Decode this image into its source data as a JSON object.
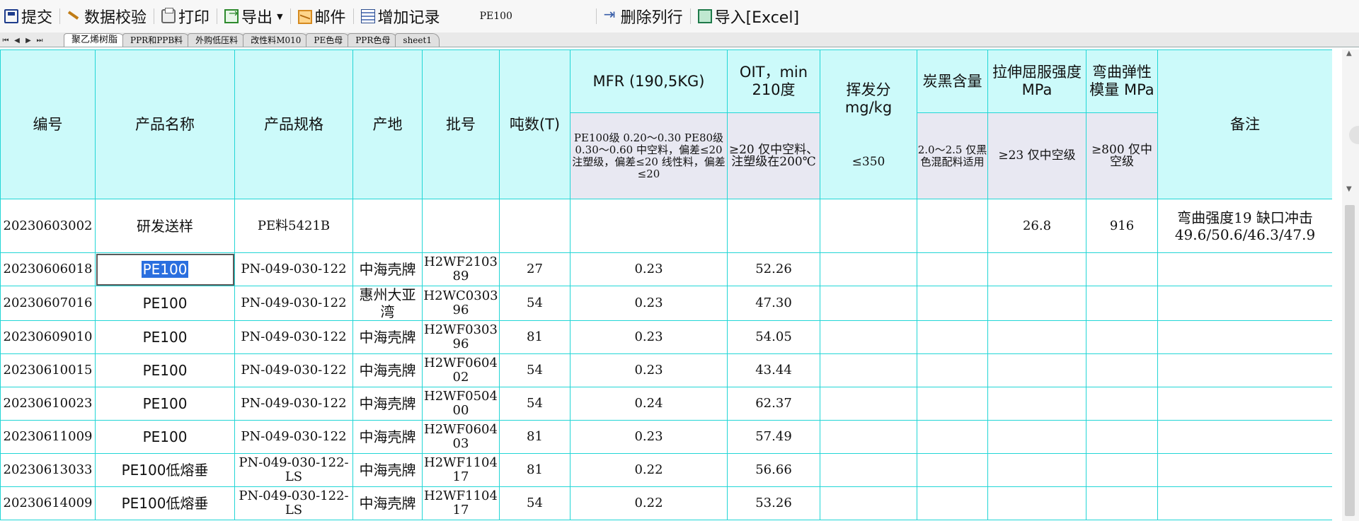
{
  "toolbar": {
    "submit": "提交",
    "validate": "数据校验",
    "print": "打印",
    "export": "导出",
    "mail": "邮件",
    "add_log": "增加记录",
    "product_field": "PE100",
    "delete_row": "删除列行",
    "import_excel": "导入[Excel]"
  },
  "tabs": [
    "聚乙烯树脂",
    "PPR和PPB料",
    "外购低压料",
    "改性料M010",
    "PE色母",
    "PPR色母",
    "sheet1"
  ],
  "header": {
    "code": "编号",
    "name": "产品名称",
    "spec": "产品规格",
    "origin": "产地",
    "batch": "批号",
    "tons": "吨数(T)",
    "mfr": "MFR (190,5KG)",
    "mfr_req": "PE100级 0.20～0.30 PE80级 0.30～0.60 中空料，偏差≤20 注塑级，偏差≤20 线性料，偏差≤20",
    "oit": "OIT，min 210度",
    "oit_req": "≥20 仅中空料、注塑级在200℃",
    "volatile": "挥发分 mg/kg",
    "volatile_req": "≤350",
    "carbon": "炭黑含量",
    "carbon_req": "2.0～2.5 仅黑色混配料适用",
    "tensile": "拉伸屈服强度 MPa",
    "tensile_req": "≥23 仅中空级",
    "flex": "弯曲弹性模量 MPa",
    "flex_req": "≥800 仅中空级",
    "remark": "备注"
  },
  "rows": [
    {
      "code": "20230603002",
      "name": "研发送样",
      "spec": "PE料5421B",
      "origin": "",
      "batch": "",
      "tons": "",
      "mfr": "",
      "oit": "",
      "volatile": "",
      "carbon": "",
      "tensile": "26.8",
      "flex": "916",
      "remark": "弯曲强度19 缺口冲击 49.6/50.6/46.3/47.9"
    },
    {
      "code": "20230606018",
      "name": "PE100",
      "spec": "PN-049-030-122",
      "origin": "中海壳牌",
      "batch": "H2WF210389",
      "tons": "27",
      "mfr": "0.23",
      "oit": "52.26",
      "volatile": "",
      "carbon": "",
      "tensile": "",
      "flex": "",
      "remark": ""
    },
    {
      "code": "20230607016",
      "name": "PE100",
      "spec": "PN-049-030-122",
      "origin": "惠州大亚湾",
      "batch": "H2WC030396",
      "tons": "54",
      "mfr": "0.23",
      "oit": "47.30",
      "volatile": "",
      "carbon": "",
      "tensile": "",
      "flex": "",
      "remark": ""
    },
    {
      "code": "20230609010",
      "name": "PE100",
      "spec": "PN-049-030-122",
      "origin": "中海壳牌",
      "batch": "H2WF030396",
      "tons": "81",
      "mfr": "0.23",
      "oit": "54.05",
      "volatile": "",
      "carbon": "",
      "tensile": "",
      "flex": "",
      "remark": ""
    },
    {
      "code": "20230610015",
      "name": "PE100",
      "spec": "PN-049-030-122",
      "origin": "中海壳牌",
      "batch": "H2WF060402",
      "tons": "54",
      "mfr": "0.23",
      "oit": "43.44",
      "volatile": "",
      "carbon": "",
      "tensile": "",
      "flex": "",
      "remark": ""
    },
    {
      "code": "20230610023",
      "name": "PE100",
      "spec": "PN-049-030-122",
      "origin": "中海壳牌",
      "batch": "H2WF050400",
      "tons": "54",
      "mfr": "0.24",
      "oit": "62.37",
      "volatile": "",
      "carbon": "",
      "tensile": "",
      "flex": "",
      "remark": ""
    },
    {
      "code": "20230611009",
      "name": "PE100",
      "spec": "PN-049-030-122",
      "origin": "中海壳牌",
      "batch": "H2WF060403",
      "tons": "81",
      "mfr": "0.23",
      "oit": "57.49",
      "volatile": "",
      "carbon": "",
      "tensile": "",
      "flex": "",
      "remark": ""
    },
    {
      "code": "20230613033",
      "name": "PE100低熔垂",
      "spec": "PN-049-030-122-LS",
      "origin": "中海壳牌",
      "batch": "H2WF110417",
      "tons": "81",
      "mfr": "0.22",
      "oit": "56.66",
      "volatile": "",
      "carbon": "",
      "tensile": "",
      "flex": "",
      "remark": ""
    },
    {
      "code": "20230614009",
      "name": "PE100低熔垂",
      "spec": "PN-049-030-122-LS",
      "origin": "中海壳牌",
      "batch": "H2WF110417",
      "tons": "54",
      "mfr": "0.22",
      "oit": "53.26",
      "volatile": "",
      "carbon": "",
      "tensile": "",
      "flex": "",
      "remark": ""
    }
  ]
}
